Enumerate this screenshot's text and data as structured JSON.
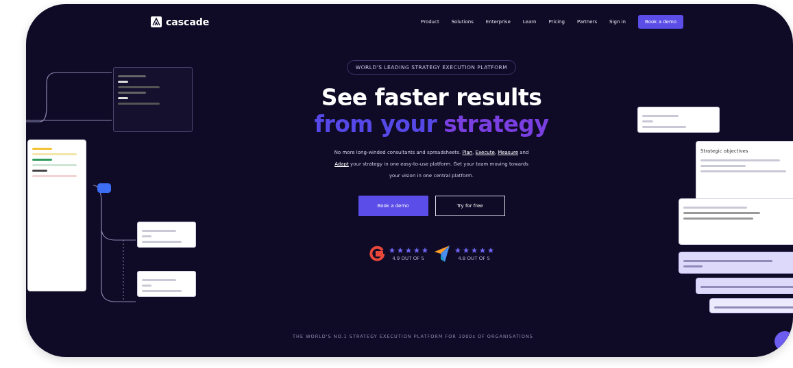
{
  "nav": {
    "logo": "cascade",
    "links": [
      "Product",
      "Solutions",
      "Enterprise",
      "Learn",
      "Pricing",
      "Partners",
      "Sign in"
    ],
    "cta": "Book a demo"
  },
  "hero": {
    "badge": "WORLD'S LEADING STRATEGY EXECUTION PLATFORM",
    "title_line_1": "See faster results",
    "title_line_2_a": "from your",
    "title_line_2_b": "strategy",
    "body": [
      {
        "kind": "text",
        "text": "No more long-winded consultants and spreadsheets. "
      },
      {
        "kind": "link",
        "text": "Plan"
      },
      {
        "kind": "text",
        "text": ", "
      },
      {
        "kind": "link",
        "text": "Execute"
      },
      {
        "kind": "text",
        "text": ", "
      },
      {
        "kind": "link",
        "text": "Measure"
      },
      {
        "kind": "text",
        "text": " and "
      },
      {
        "kind": "link",
        "text": "Adapt"
      },
      {
        "kind": "text",
        "text": " your strategy in one easy-to-use platform. Get your team moving towards your vision in one central platform."
      }
    ],
    "primary_button": "Book a demo",
    "secondary_button": "Try for free"
  },
  "ratings": [
    {
      "kind": "g2",
      "stars": 5,
      "caption": "4.9 OUT OF 5"
    },
    {
      "kind": "capterra",
      "stars": 5,
      "caption": "4.8 OUT OF 5"
    }
  ],
  "footer_line": "THE WORLD'S NO.1 STRATEGY EXECUTION PLATFORM FOR 1000s OF ORGANISATIONS",
  "side_card": {
    "title": "Strategic objectives"
  }
}
